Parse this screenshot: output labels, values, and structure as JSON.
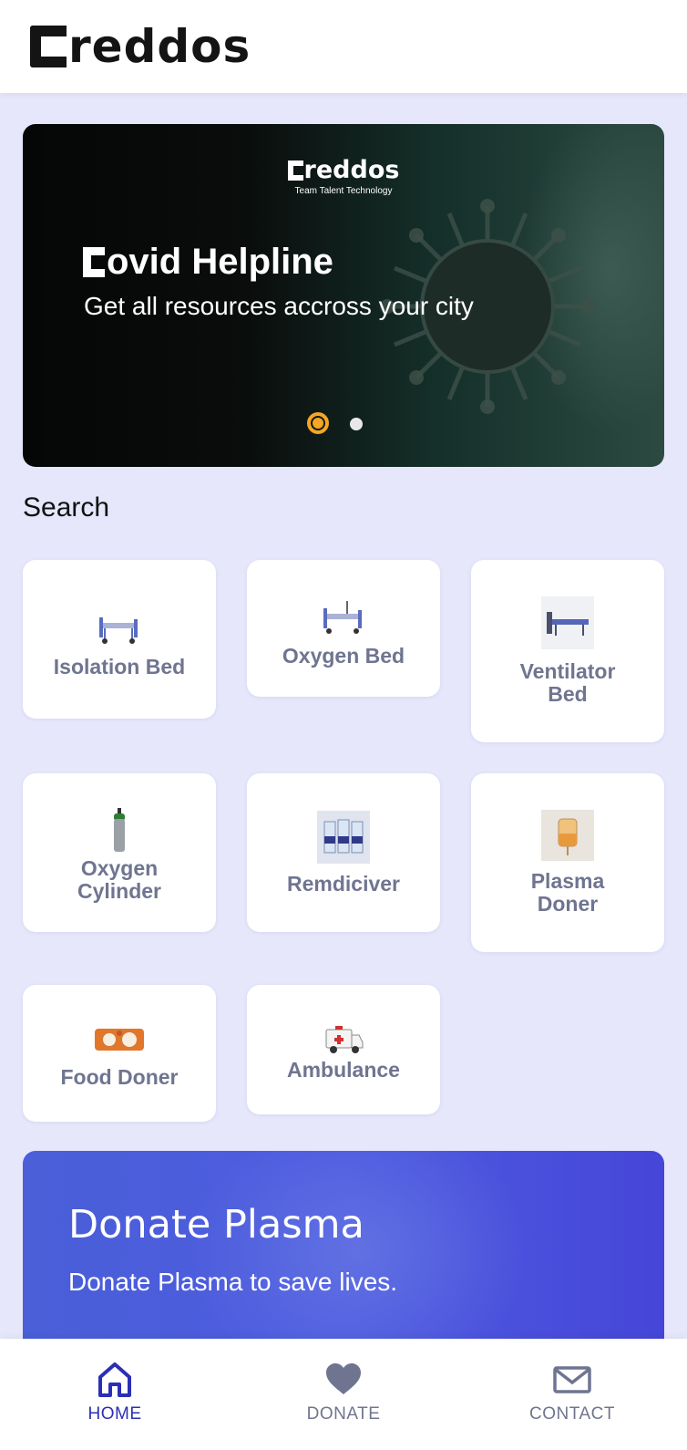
{
  "header": {
    "logo_text": "reddos"
  },
  "banner": {
    "brand_text": "reddos",
    "tagline": "Team Talent Technology",
    "title_text": "ovid Helpline",
    "subtitle": "Get all resources accross your city",
    "active_slide": 1,
    "slide_count": 2,
    "accent_color": "#f5a623"
  },
  "search": {
    "title": "Search",
    "items": [
      {
        "label": "Isolation Bed",
        "icon": "hospital-bed-icon"
      },
      {
        "label": "Oxygen Bed",
        "icon": "oxygen-bed-icon"
      },
      {
        "label": "Ventilator Bed",
        "icon": "ventilator-bed-icon"
      },
      {
        "label": "Oxygen Cylinder",
        "icon": "oxygen-cylinder-icon"
      },
      {
        "label": "Remdiciver",
        "icon": "vial-icon"
      },
      {
        "label": "Plasma Doner",
        "icon": "plasma-bag-icon"
      },
      {
        "label": "Food Doner",
        "icon": "food-tray-icon"
      },
      {
        "label": "Ambulance",
        "icon": "ambulance-icon"
      }
    ]
  },
  "donate_card": {
    "title": "Donate Plasma",
    "subtitle": "Donate Plasma to save lives."
  },
  "nav": {
    "items": [
      {
        "label": "HOME",
        "icon": "home-icon",
        "active": true
      },
      {
        "label": "DONATE",
        "icon": "heart-icon",
        "active": false
      },
      {
        "label": "CONTACT",
        "icon": "mail-icon",
        "active": false
      }
    ],
    "active_color": "#2b2fb5",
    "inactive_color": "#6f7590"
  }
}
